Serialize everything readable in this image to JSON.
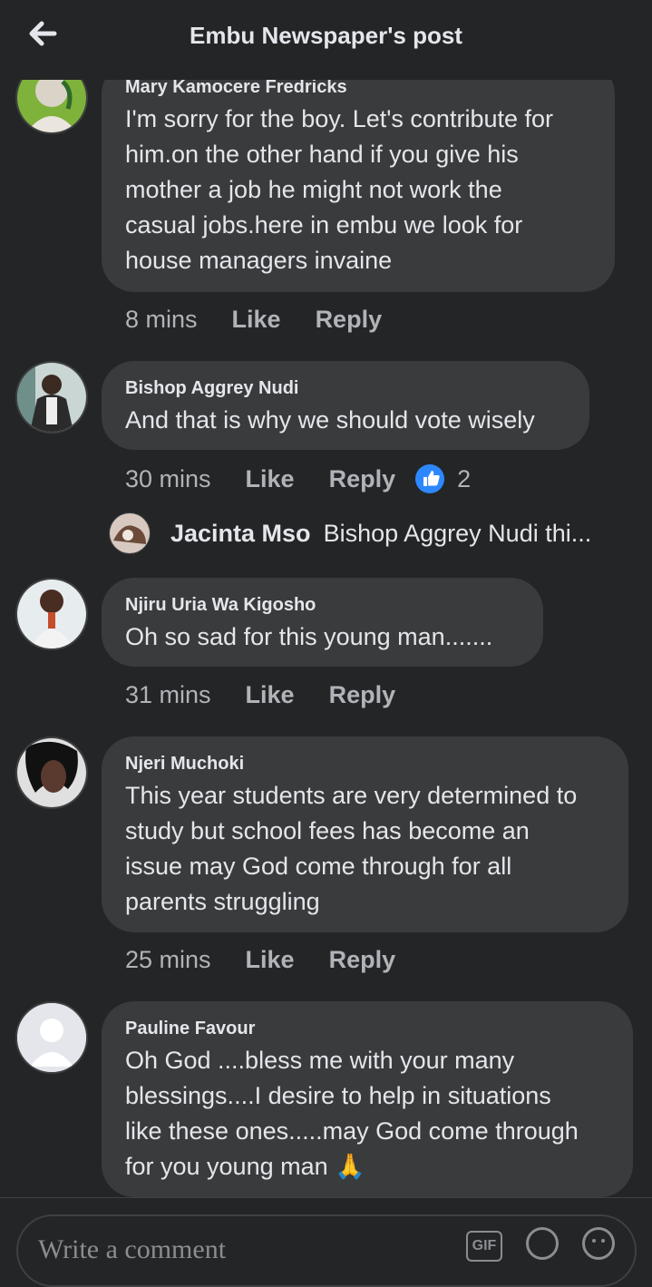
{
  "header": {
    "title": "Embu Newspaper's post"
  },
  "comments": [
    {
      "name": "Mary Kamocere Fredricks",
      "lines": [
        "I'm sorry for the boy. Let's contribute for",
        "him.on the other hand if you give his",
        "mother a job he might not work the",
        "casual jobs.here in embu we look for",
        "house managers invaine"
      ],
      "time": "8 mins",
      "like": "Like",
      "reply": "Reply"
    },
    {
      "name": "Bishop Aggrey Nudi",
      "lines": [
        "And that is why we should vote wisely"
      ],
      "time": "30 mins",
      "like": "Like",
      "reply": "Reply",
      "reactions": "2"
    },
    {
      "name": "Njiru Uria Wa Kigosho",
      "lines": [
        "Oh so sad for this young man......."
      ],
      "time": "31 mins",
      "like": "Like",
      "reply": "Reply"
    },
    {
      "name": "Njeri Muchoki",
      "lines": [
        "This year students are very determined to",
        "study but school fees has become an",
        "issue may God come through for all",
        "parents struggling"
      ],
      "time": "25 mins",
      "like": "Like",
      "reply": "Reply"
    },
    {
      "name": "Pauline Favour",
      "lines": [
        "Oh God ....bless me with your many",
        "blessings....I desire to help in situations",
        "like these ones.....may God come through",
        "for you young man 🙏"
      ]
    }
  ],
  "reply_preview": {
    "name": "Jacinta Mso",
    "text": "Bishop Aggrey Nudi thi..."
  },
  "composer": {
    "placeholder": "Write a comment",
    "gif_label": "GIF"
  },
  "colors": {
    "background": "#242526",
    "bubble": "#3a3b3c",
    "accent": "#2d88ff",
    "muted": "#b0b3b8"
  }
}
